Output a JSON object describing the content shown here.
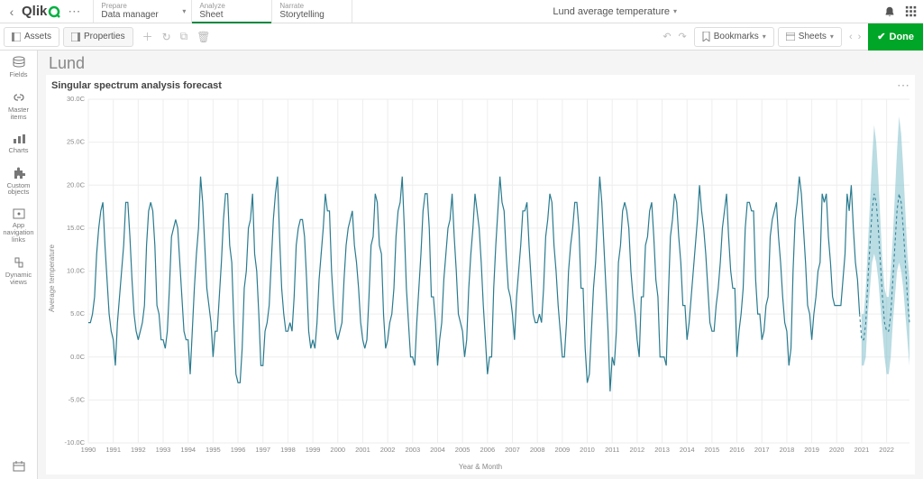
{
  "brand": "Qlik",
  "top_tabs": [
    {
      "sup": "Prepare",
      "main": "Data manager"
    },
    {
      "sup": "Analyze",
      "main": "Sheet"
    },
    {
      "sup": "Narrate",
      "main": "Storytelling"
    }
  ],
  "app_name": "Lund average temperature",
  "secondbar": {
    "assets": "Assets",
    "properties": "Properties",
    "bookmarks": "Bookmarks",
    "sheets": "Sheets",
    "done": "Done"
  },
  "leftpanel": {
    "fields": "Fields",
    "master": "Master items",
    "charts": "Charts",
    "custom": "Custom objects",
    "nav": "App navigation links",
    "dynamic": "Dynamic views"
  },
  "sheet_title": "Lund",
  "chart_title": "Singular spectrum analysis forecast",
  "yaxis_label": "Average temperature",
  "xaxis_label": "Year & Month",
  "chart_data": {
    "type": "line",
    "ylabel": "Average temperature",
    "xlabel": "Year & Month",
    "title": "Singular spectrum analysis forecast",
    "ylim": [
      -10,
      30
    ],
    "yticks": [
      "-10.0C",
      "-5.0C",
      "0.0C",
      "5.0C",
      "10.0C",
      "15.0C",
      "20.0C",
      "25.0C",
      "30.0C"
    ],
    "xticks": [
      "1990",
      "1991",
      "1992",
      "1993",
      "1994",
      "1995",
      "1996",
      "1997",
      "1998",
      "1999",
      "2000",
      "2001",
      "2002",
      "2003",
      "2004",
      "2005",
      "2006",
      "2007",
      "2008",
      "2009",
      "2010",
      "2011",
      "2012",
      "2013",
      "2014",
      "2015",
      "2016",
      "2017",
      "2018",
      "2019",
      "2020",
      "2021",
      "2022"
    ],
    "series": [
      {
        "name": "Average temperature (monthly)",
        "period_years": [
          1990,
          2020
        ],
        "values": [
          4.0,
          4.0,
          5.0,
          7.0,
          12.0,
          15.0,
          17.0,
          18.0,
          13.0,
          9.0,
          5.0,
          3.0,
          2.0,
          -1.0,
          4.0,
          7.0,
          10.0,
          13.0,
          18.0,
          18.0,
          14.0,
          9.0,
          5.0,
          3.0,
          2.0,
          3.0,
          4.0,
          6.0,
          13.0,
          17.0,
          18.0,
          17.0,
          13.0,
          6.0,
          5.0,
          2.0,
          2.0,
          1.0,
          3.0,
          8.0,
          14.0,
          15.0,
          16.0,
          15.0,
          11.0,
          7.0,
          3.0,
          2.0,
          2.0,
          -2.0,
          3.0,
          8.0,
          12.0,
          15.0,
          21.0,
          18.0,
          13.0,
          8.0,
          6.0,
          4.0,
          0.0,
          3.0,
          3.0,
          7.0,
          11.0,
          16.0,
          19.0,
          19.0,
          13.0,
          11.0,
          4.0,
          -2.0,
          -3.0,
          -3.0,
          1.0,
          8.0,
          10.0,
          15.0,
          16.0,
          19.0,
          12.0,
          10.0,
          5.0,
          -1.0,
          -1.0,
          3.0,
          4.0,
          6.0,
          11.0,
          16.0,
          19.0,
          21.0,
          14.0,
          8.0,
          5.0,
          3.0,
          3.0,
          4.0,
          3.0,
          7.0,
          13.0,
          15.0,
          16.0,
          16.0,
          14.0,
          9.0,
          3.0,
          1.0,
          2.0,
          1.0,
          4.0,
          9.0,
          12.0,
          15.0,
          19.0,
          17.0,
          17.0,
          10.0,
          6.0,
          3.0,
          2.0,
          3.0,
          4.0,
          9.0,
          13.0,
          15.0,
          16.0,
          17.0,
          13.0,
          11.0,
          8.0,
          4.0,
          2.0,
          1.0,
          2.0,
          7.0,
          13.0,
          14.0,
          19.0,
          18.0,
          13.0,
          12.0,
          5.0,
          1.0,
          2.0,
          4.0,
          5.0,
          8.0,
          14.0,
          17.0,
          18.0,
          21.0,
          15.0,
          8.0,
          4.0,
          0.0,
          0.0,
          -1.0,
          4.0,
          8.0,
          12.0,
          17.0,
          19.0,
          19.0,
          15.0,
          7.0,
          7.0,
          4.0,
          -1.0,
          2.0,
          4.0,
          9.0,
          12.0,
          15.0,
          16.0,
          19.0,
          14.0,
          10.0,
          5.0,
          4.0,
          3.0,
          0.0,
          2.0,
          8.0,
          12.0,
          15.0,
          19.0,
          17.0,
          15.0,
          11.0,
          6.0,
          2.0,
          -2.0,
          0.0,
          0.0,
          8.0,
          13.0,
          17.0,
          21.0,
          18.0,
          17.0,
          12.0,
          8.0,
          7.0,
          5.0,
          2.0,
          7.0,
          10.0,
          13.0,
          17.0,
          17.0,
          18.0,
          13.0,
          9.0,
          5.0,
          4.0,
          4.0,
          5.0,
          4.0,
          8.0,
          14.0,
          16.0,
          19.0,
          18.0,
          13.0,
          10.0,
          6.0,
          3.0,
          0.0,
          0.0,
          4.0,
          10.0,
          13.0,
          15.0,
          18.0,
          18.0,
          15.0,
          8.0,
          8.0,
          1.0,
          -3.0,
          -2.0,
          3.0,
          8.0,
          11.0,
          16.0,
          21.0,
          18.0,
          13.0,
          8.0,
          3.0,
          -4.0,
          0.0,
          -1.0,
          3.0,
          11.0,
          13.0,
          17.0,
          18.0,
          17.0,
          15.0,
          10.0,
          7.0,
          5.0,
          2.0,
          0.0,
          7.0,
          7.0,
          13.0,
          14.0,
          17.0,
          18.0,
          14.0,
          9.0,
          7.0,
          0.0,
          0.0,
          0.0,
          -1.0,
          7.0,
          14.0,
          16.0,
          19.0,
          18.0,
          14.0,
          11.0,
          6.0,
          6.0,
          2.0,
          4.0,
          7.0,
          10.0,
          13.0,
          16.0,
          20.0,
          17.0,
          15.0,
          12.0,
          8.0,
          4.0,
          3.0,
          3.0,
          6.0,
          8.0,
          11.0,
          15.0,
          17.0,
          19.0,
          14.0,
          10.0,
          8.0,
          8.0,
          0.0,
          3.0,
          5.0,
          8.0,
          15.0,
          18.0,
          18.0,
          17.0,
          17.0,
          9.0,
          5.0,
          5.0,
          2.0,
          3.0,
          6.0,
          7.0,
          14.0,
          16.0,
          17.0,
          18.0,
          14.0,
          11.0,
          7.0,
          4.0,
          3.0,
          -1.0,
          1.0,
          10.0,
          16.0,
          18.0,
          21.0,
          19.0,
          15.0,
          11.0,
          6.0,
          5.0,
          2.0,
          5.0,
          7.0,
          10.0,
          11.0,
          19.0,
          18.0,
          19.0,
          14.0,
          11.0,
          7.0,
          6.0,
          6.0,
          6.0,
          6.0,
          9.0,
          12.0,
          19.0,
          17.0,
          20.0,
          15.0,
          11.0,
          9.0,
          5.0
        ]
      }
    ],
    "forecast": {
      "period_years": [
        2021,
        2023
      ],
      "mean": [
        2.0,
        2.0,
        4.0,
        9.0,
        13.0,
        17.0,
        19.0,
        18.0,
        15.0,
        11.0,
        7.0,
        4.0,
        3.0,
        3.0,
        5.0,
        9.0,
        13.0,
        17.0,
        19.0,
        18.0,
        15.0,
        11.0,
        7.0,
        4.0
      ],
      "upper": [
        5.0,
        5.0,
        8.0,
        13.0,
        18.0,
        23.0,
        27.0,
        25.0,
        21.0,
        16.0,
        11.0,
        8.0,
        7.0,
        7.0,
        10.0,
        14.0,
        19.0,
        24.0,
        28.0,
        26.0,
        22.0,
        17.0,
        12.0,
        9.0
      ],
      "lower": [
        -1.0,
        -1.0,
        0.0,
        5.0,
        8.0,
        11.0,
        12.0,
        11.0,
        9.0,
        6.0,
        3.0,
        0.0,
        -2.0,
        -2.0,
        0.0,
        4.0,
        7.0,
        10.0,
        11.0,
        10.0,
        8.0,
        5.0,
        2.0,
        -1.0
      ]
    }
  }
}
